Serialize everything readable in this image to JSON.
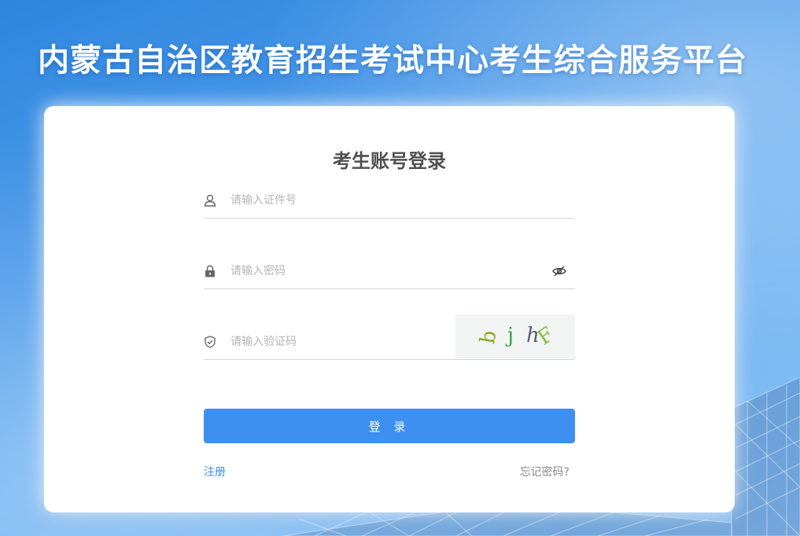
{
  "site": {
    "title": "内蒙古自治区教育招生考试中心考生综合服务平台"
  },
  "login": {
    "title": "考生账号登录",
    "id_field": {
      "placeholder": "请输入证件号",
      "value": ""
    },
    "password_field": {
      "placeholder": "请输入密码",
      "value": ""
    },
    "captcha_field": {
      "placeholder": "请输入验证码",
      "value": ""
    },
    "captcha_image": {
      "chars": [
        "b",
        "j",
        "h",
        "F"
      ],
      "colors": [
        "#8aa823",
        "#2fa54a",
        "#555a73",
        "#7cc243"
      ]
    },
    "submit_label": "登 录",
    "register_label": "注册",
    "forgot_label": "忘记密码?"
  },
  "icons": {
    "id": "user-icon",
    "password": "lock-icon",
    "captcha": "shield-check-icon",
    "toggle": "eye-off-icon"
  },
  "colors": {
    "primary": "#3d8ff0",
    "title_text": "#505050",
    "background": "#4b9aea"
  }
}
